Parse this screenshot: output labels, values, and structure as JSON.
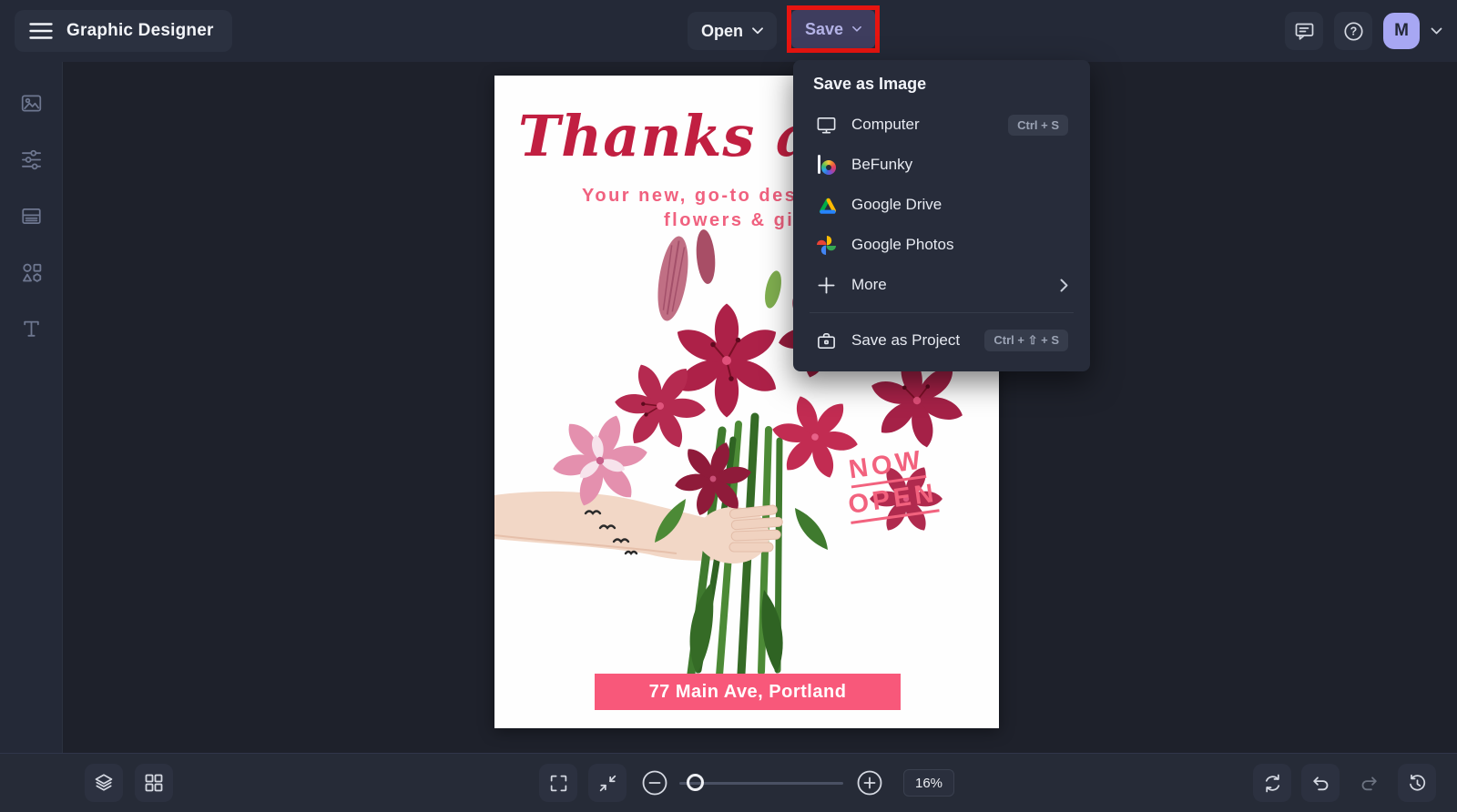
{
  "app": {
    "title": "Graphic Designer"
  },
  "topbar": {
    "open_label": "Open",
    "save_label": "Save"
  },
  "user": {
    "avatar_initial": "M"
  },
  "save_menu": {
    "header": "Save as Image",
    "items": [
      {
        "label": "Computer",
        "icon": "computer-icon",
        "shortcut": "Ctrl + S"
      },
      {
        "label": "BeFunky",
        "icon": "befunky-icon"
      },
      {
        "label": "Google Drive",
        "icon": "google-drive-icon"
      },
      {
        "label": "Google Photos",
        "icon": "google-photos-icon"
      },
      {
        "label": "More",
        "icon": "plus-icon",
        "has_submenu": true
      }
    ],
    "footer_item": {
      "label": "Save as Project",
      "icon": "briefcase-icon",
      "shortcut": "Ctrl + ⇧ + S"
    }
  },
  "sidebar": {
    "items": [
      {
        "icon": "images-icon"
      },
      {
        "icon": "edit-sliders-icon"
      },
      {
        "icon": "templates-icon"
      },
      {
        "icon": "graphics-shapes-icon"
      },
      {
        "icon": "text-icon"
      }
    ]
  },
  "canvas_design": {
    "headline": "Thanks a",
    "subtitle_line1": "Your new, go-to des",
    "subtitle_line2": "flowers & gi",
    "stamp_line1": "NOW",
    "stamp_line2": "OPEN",
    "address": "77 Main Ave, Portland"
  },
  "bottombar": {
    "zoom_level": "16%"
  },
  "colors": {
    "topbar_bg": "#242937",
    "workspace_bg": "#1e212b",
    "save_button_bg": "#3e3d5e",
    "save_button_text": "#b3b2e6",
    "highlight_red": "#e71410",
    "avatar_bg": "#a7a7f3",
    "headline_red": "#c11f41",
    "design_pink": "#f0617f",
    "banner_pink": "#f8587a"
  }
}
